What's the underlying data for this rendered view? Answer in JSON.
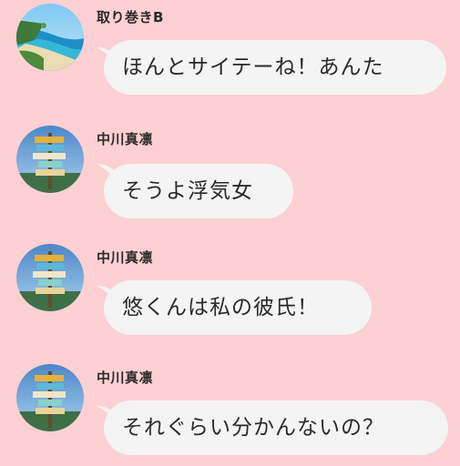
{
  "messages": [
    {
      "sender": "取り巻きB",
      "text": "ほんとサイテーね！あんた",
      "avatar": "beach-photo"
    },
    {
      "sender": "中川真凛",
      "text": "そうよ浮気女",
      "avatar": "signpost-photo"
    },
    {
      "sender": "中川真凛",
      "text": "悠くんは私の彼氏！",
      "avatar": "signpost-photo"
    },
    {
      "sender": "中川真凛",
      "text": "それぐらい分かんないの？",
      "avatar": "signpost-photo"
    }
  ],
  "colors": {
    "background": "#fdd0d3",
    "bubble": "#f4f4f4",
    "text": "#2a2a2a"
  }
}
